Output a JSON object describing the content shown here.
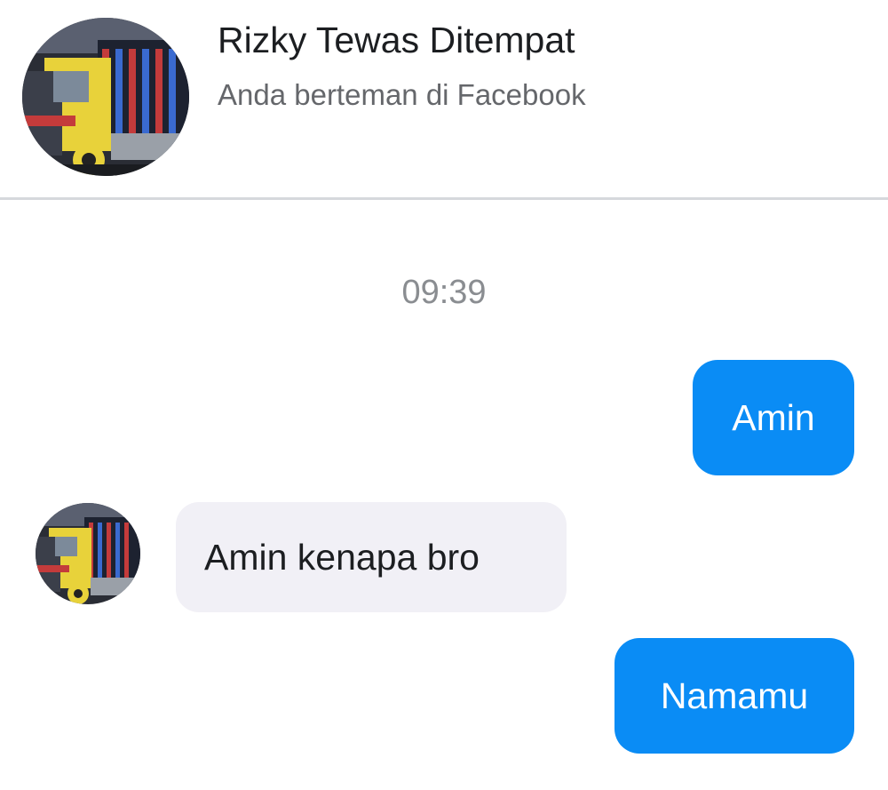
{
  "header": {
    "contact_name": "Rizky Tewas Ditempat",
    "subtitle": "Anda berteman di Facebook"
  },
  "conversation": {
    "timestamp": "09:39",
    "messages": [
      {
        "direction": "outgoing",
        "text": "Amin"
      },
      {
        "direction": "incoming",
        "text": "Amin kenapa bro"
      },
      {
        "direction": "outgoing",
        "text": "Namamu"
      }
    ]
  },
  "colors": {
    "outgoing_bubble": "#0a8cf5",
    "incoming_bubble": "#f1f0f6"
  }
}
